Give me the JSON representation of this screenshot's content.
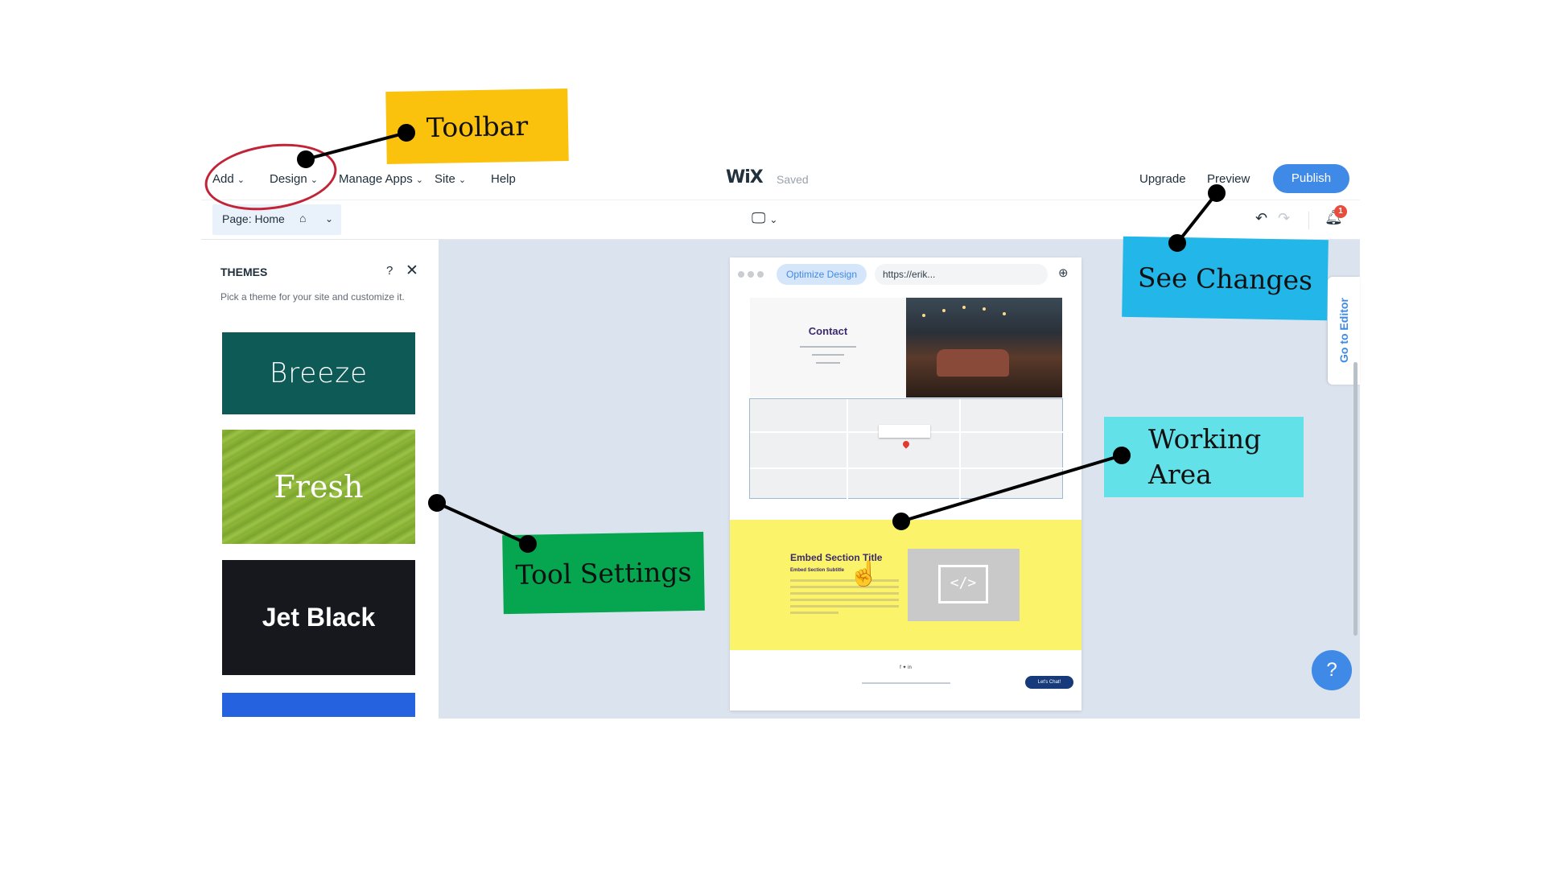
{
  "toolbar": {
    "menu": [
      "Add",
      "Design",
      "Manage Apps",
      "Site",
      "Help"
    ],
    "logo": "WiX",
    "status": "Saved",
    "upgrade": "Upgrade",
    "preview": "Preview",
    "publish": "Publish"
  },
  "subbar": {
    "page_label": "Page: Home",
    "notifications_count": "1"
  },
  "themes_panel": {
    "title": "THEMES",
    "help": "?",
    "description": "Pick a theme for your site and customize it.",
    "themes": [
      "Breeze",
      "Fresh",
      "Jet Black"
    ]
  },
  "preview": {
    "optimize_button": "Optimize Design",
    "url": "https://erik...",
    "contact_title": "Contact",
    "embed_title": "Embed Section Title",
    "embed_subtitle": "Embed Section Subtitle",
    "chat_button": "Let's Chat!"
  },
  "side_tab": "Go to Editor",
  "help_bubble": "?",
  "annotations": {
    "toolbar": "Toolbar",
    "see_changes": "See Changes",
    "working_area_line1": "Working",
    "working_area_line2": "Area",
    "tool_settings": "Tool Settings"
  },
  "colors": {
    "accent": "#3f8ae6",
    "toolbar_note": "#fbc20d",
    "see_changes_note": "#23b6e8",
    "working_area_note": "#63e1e8",
    "tool_settings_note": "#06a54f",
    "highlight_ellipse": "#c22336",
    "theme_breeze": "#0d5a57",
    "theme_jet_black": "#17181d"
  }
}
